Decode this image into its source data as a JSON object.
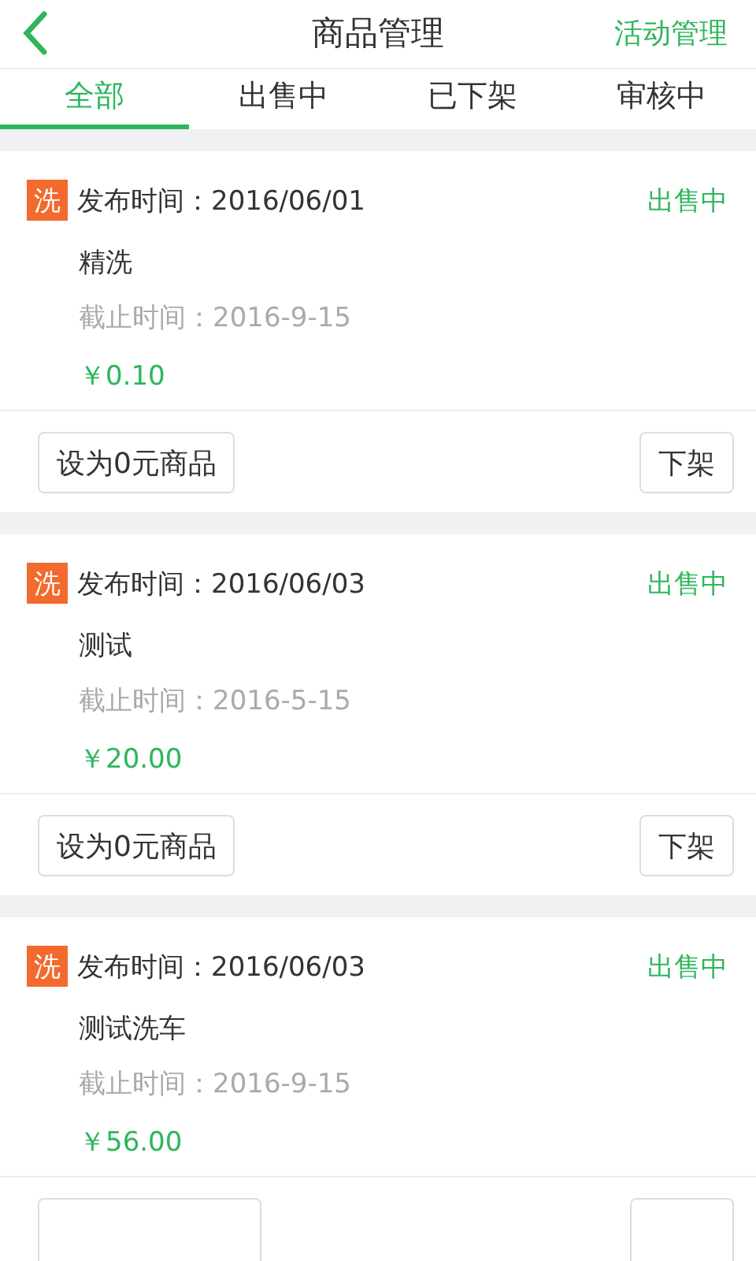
{
  "header": {
    "title": "商品管理",
    "action": "活动管理"
  },
  "tabs": [
    {
      "label": "全部",
      "selected": true
    },
    {
      "label": "出售中",
      "selected": false
    },
    {
      "label": "已下架",
      "selected": false
    },
    {
      "label": "审核中",
      "selected": false
    }
  ],
  "products": [
    {
      "tag": "洗",
      "published": "发布时间：2016/06/01",
      "status": "出售中",
      "name": "精洗",
      "deadline": "截止时间：2016-9-15",
      "price": "￥0.10",
      "buttons": [
        "设为0元商品",
        "下架"
      ]
    },
    {
      "tag": "洗",
      "published": "发布时间：2016/06/03",
      "status": "出售中",
      "name": "测试",
      "deadline": "截止时间：2016-5-15",
      "price": "￥20.00",
      "buttons": [
        "设为0元商品",
        "下架"
      ]
    },
    {
      "tag": "洗",
      "published": "发布时间：2016/06/03",
      "status": "出售中",
      "name": "测试洗车",
      "deadline": "截止时间：2016-9-15",
      "price": "￥56.00",
      "footer_cut": true
    }
  ]
}
